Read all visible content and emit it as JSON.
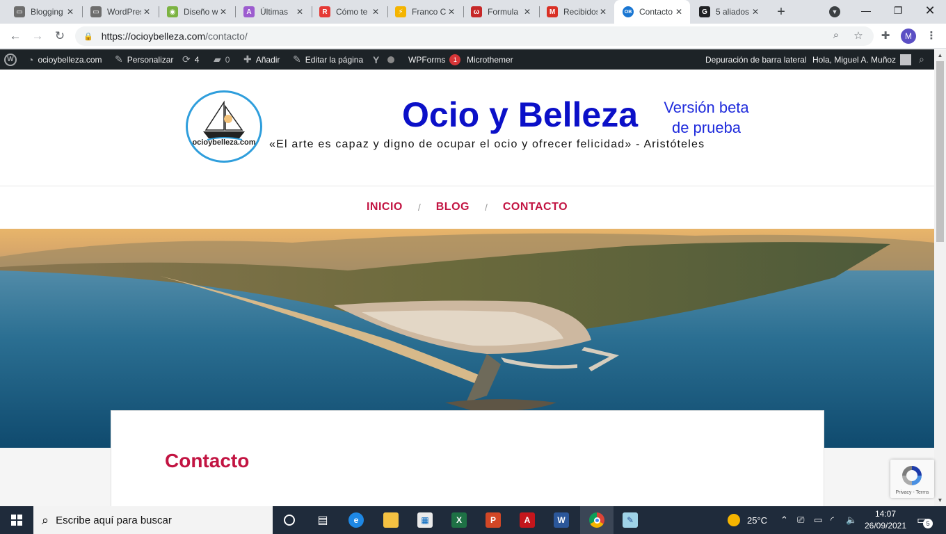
{
  "browser": {
    "tabs": [
      {
        "title": "Blogging",
        "icon": "document-icon",
        "color": "#6d6d6d"
      },
      {
        "title": "WordPress",
        "icon": "document-icon",
        "color": "#6d6d6d"
      },
      {
        "title": "Diseño web",
        "icon": "swirl-icon",
        "color": "#7cb342"
      },
      {
        "title": "Últimas",
        "icon": "letter-a-icon",
        "color": "#9c5ccf"
      },
      {
        "title": "Cómo te",
        "icon": "letter-r-icon",
        "color": "#e53935"
      },
      {
        "title": "Franco C",
        "icon": "bolt-icon",
        "color": "#f4b400"
      },
      {
        "title": "Formula",
        "icon": "wpforms-icon",
        "color": "#c62828"
      },
      {
        "title": "Recibidos",
        "icon": "gmail-icon",
        "color": "#d93025"
      },
      {
        "title": "Contacto",
        "icon": "ob-icon",
        "color": "#1976d2"
      },
      {
        "title": "5 aliados",
        "icon": "letter-g-icon",
        "color": "#202124"
      }
    ],
    "new_tab": "+",
    "url_host": "https://ocioybelleza.com",
    "url_path": "/contacto/",
    "profile_initial": "M"
  },
  "adminbar": {
    "site": "ocioybelleza.com",
    "customize": "Personalizar",
    "updates": "4",
    "comments": "0",
    "add": "Añadir",
    "edit": "Editar la página",
    "wpforms": "WPForms",
    "wpforms_count": "1",
    "microthemer": "Microthemer",
    "sidebar_debug": "Depuración de barra lateral",
    "greeting": "Hola, Miguel A. Muñoz"
  },
  "site": {
    "logo_text": "ocioybelleza.com",
    "title": "Ocio y Belleza",
    "beta_line1": "Versión beta",
    "beta_line2": "de prueba",
    "tagline": "«El arte es capaz y digno de ocupar el ocio y ofrecer felicidad» - Aristóteles",
    "menu": [
      "INICIO",
      "BLOG",
      "CONTACTO"
    ],
    "menu_separator": "/",
    "page_title": "Contacto",
    "accent_color": "#c21442",
    "title_color": "#0b10c8"
  },
  "recaptcha": {
    "privacy": "Privacy - Terms"
  },
  "taskbar": {
    "search_placeholder": "Escribe aquí para buscar",
    "weather": "25°C",
    "time": "14:07",
    "date": "26/09/2021",
    "notifications": "5"
  }
}
